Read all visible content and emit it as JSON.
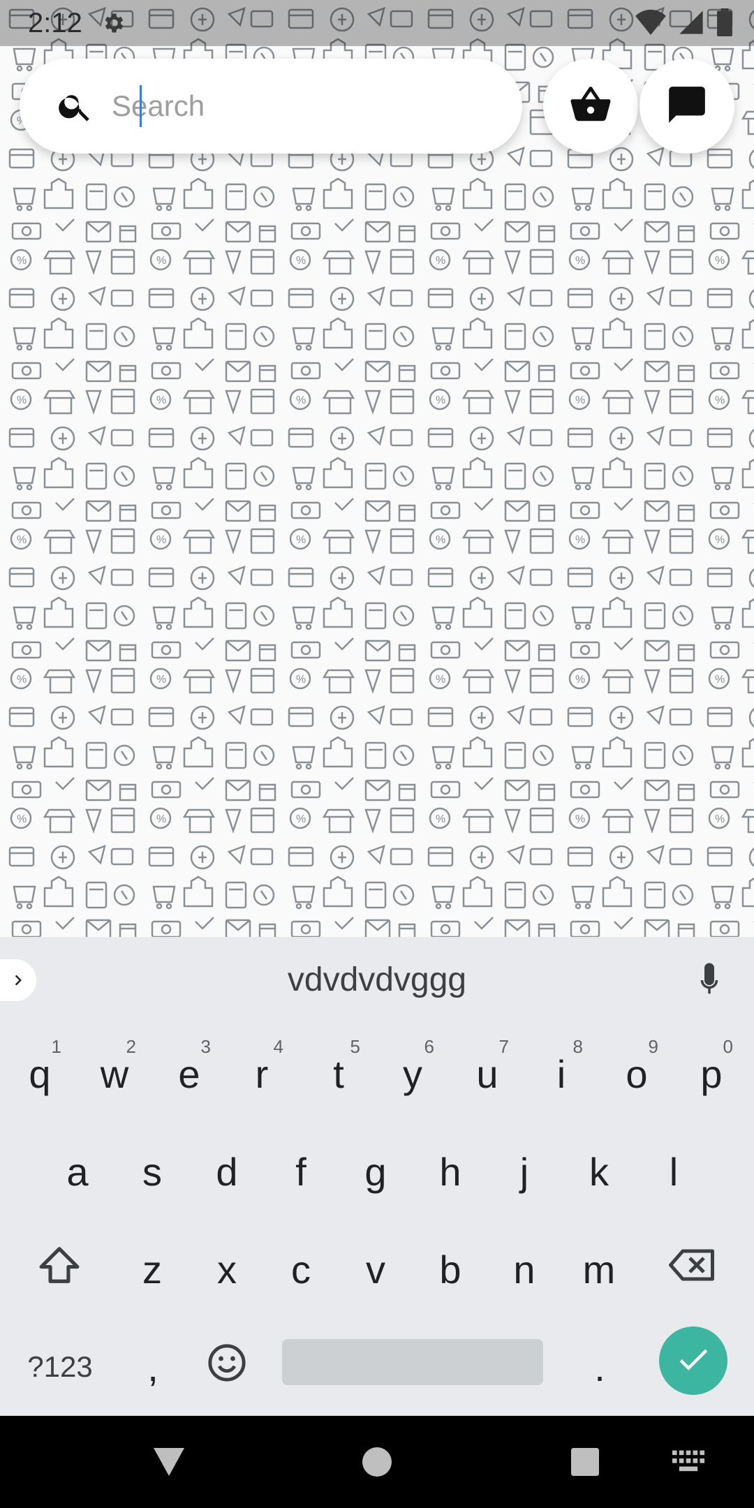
{
  "status_bar": {
    "time": "2:12",
    "icons": [
      "gear-icon",
      "wifi-icon",
      "cellular-icon",
      "battery-icon"
    ]
  },
  "search": {
    "placeholder": "Search",
    "value": "",
    "icon": "search-icon"
  },
  "header_buttons": [
    {
      "name": "basket-button",
      "icon": "basket-icon"
    },
    {
      "name": "chat-button",
      "icon": "chat-icon"
    }
  ],
  "keyboard": {
    "suggestion": "vdvdvdvggg",
    "row1": [
      {
        "key": "q",
        "hint": "1"
      },
      {
        "key": "w",
        "hint": "2"
      },
      {
        "key": "e",
        "hint": "3"
      },
      {
        "key": "r",
        "hint": "4"
      },
      {
        "key": "t",
        "hint": "5"
      },
      {
        "key": "y",
        "hint": "6"
      },
      {
        "key": "u",
        "hint": "7"
      },
      {
        "key": "i",
        "hint": "8"
      },
      {
        "key": "o",
        "hint": "9"
      },
      {
        "key": "p",
        "hint": "0"
      }
    ],
    "row2": [
      "a",
      "s",
      "d",
      "f",
      "g",
      "h",
      "j",
      "k",
      "l"
    ],
    "row3": [
      "z",
      "x",
      "c",
      "v",
      "b",
      "n",
      "m"
    ],
    "symbols_label": "?123",
    "comma": ",",
    "period": ".",
    "accent_color": "#3cb5a1"
  },
  "nav_bar": {
    "buttons": [
      "back-icon",
      "home-icon",
      "recents-icon",
      "keyboard-switch-icon"
    ]
  }
}
